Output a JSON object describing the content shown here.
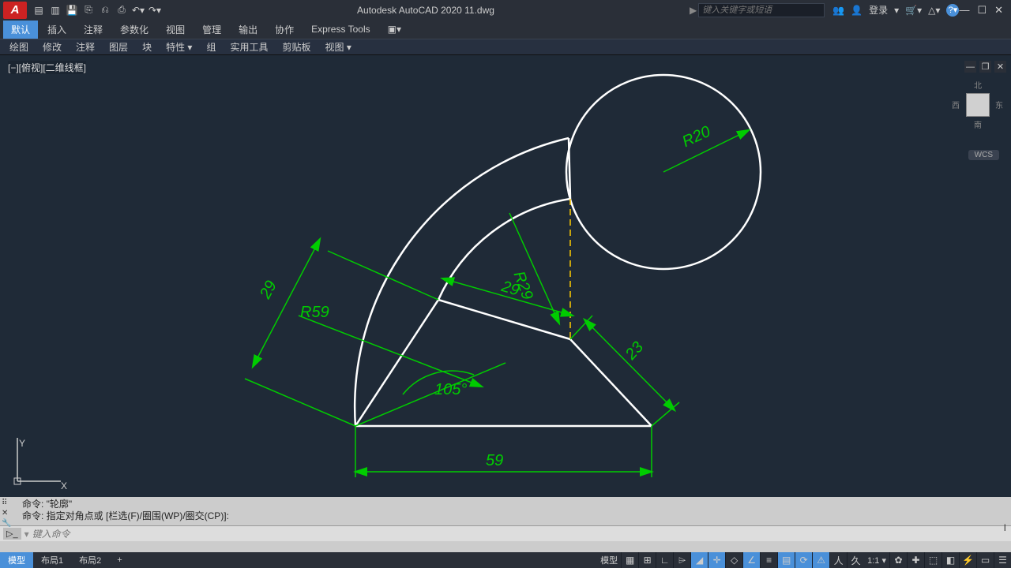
{
  "app": {
    "title": "Autodesk AutoCAD 2020   11.dwg"
  },
  "search": {
    "placeholder": "键入关键字或短语",
    "login": "登录"
  },
  "ribbon": {
    "tabs": [
      "默认",
      "插入",
      "注释",
      "参数化",
      "视图",
      "管理",
      "输出",
      "协作",
      "Express Tools"
    ]
  },
  "panels": {
    "items": [
      "绘图",
      "修改",
      "注释",
      "图层",
      "块",
      "特性 ▾",
      "组",
      "实用工具",
      "剪贴板",
      "视图 ▾"
    ]
  },
  "viewport": {
    "label": "[−][俯视][二维线框]"
  },
  "viewcube": {
    "n": "北",
    "s": "南",
    "e": "东",
    "w": "西",
    "wcs": "WCS"
  },
  "ucs": {
    "x": "X",
    "y": "Y"
  },
  "dims": {
    "r20": "R20",
    "r29": "R29",
    "r59": "R59",
    "d59": "59",
    "d29a": "29",
    "d29b": "29",
    "d23": "23",
    "ang": "105°"
  },
  "cmd": {
    "line1": "命令:  \"轮廓\"",
    "line2": "命令: 指定对角点或 [栏选(F)/圈围(WP)/圈交(CP)]:",
    "placeholder": "键入命令",
    "iconlabel": "▷_"
  },
  "status": {
    "tabs": [
      "模型",
      "布局1",
      "布局2",
      "+"
    ],
    "modelLabel": "模型",
    "scale": "1:1 ▾"
  }
}
